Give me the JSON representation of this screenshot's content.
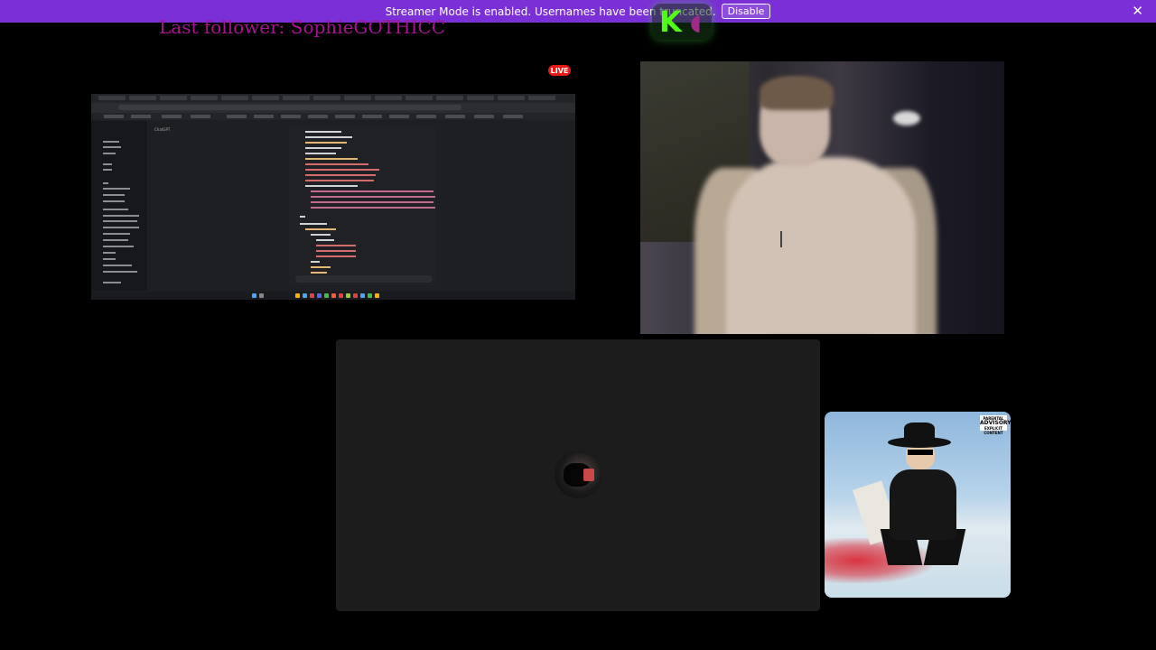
{
  "streamer_mode_bar": {
    "message": "Streamer Mode is enabled. Usernames have been truncated.",
    "disable_label": "Disable",
    "close_glyph": "✕",
    "color": "#7b2fd6"
  },
  "overlay": {
    "last_follower": "Last follower: SophieGOTHICC",
    "follower_color": "#a5148f",
    "kick_logo_letter": "K",
    "kick_logo_color": "#53fc18"
  },
  "live_badge": {
    "label": "LIVE",
    "color": "#e91916"
  },
  "screen_share": {
    "app_label": "ChatGPT"
  },
  "album_art": {
    "advisory_top": "PARENTAL",
    "advisory_big": "ADVISORY",
    "advisory_bottom": "EXPLICIT CONTENT"
  },
  "icons": {
    "close": "close-icon",
    "kick_logo": "kick-logo-icon"
  }
}
